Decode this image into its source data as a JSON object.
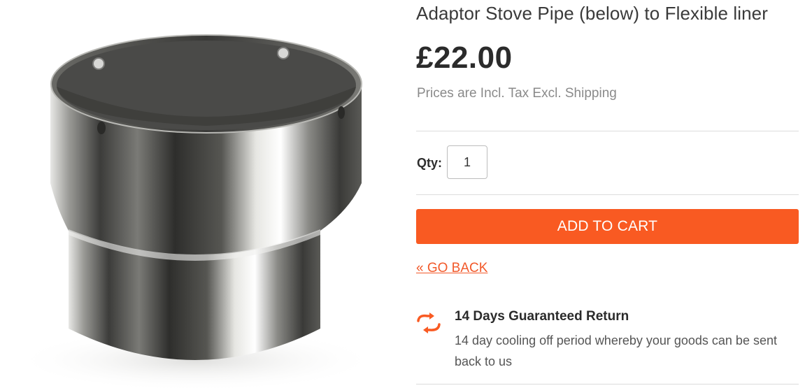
{
  "product": {
    "title": "Adaptor Stove Pipe (below) to Flexible liner",
    "price": "£22.00",
    "tax_note": "Prices are Incl. Tax Excl. Shipping",
    "image_name": "adaptor-stove-pipe-image"
  },
  "quantity": {
    "label": "Qty:",
    "value": "1"
  },
  "actions": {
    "add_to_cart": "ADD TO CART",
    "go_back": "« GO BACK"
  },
  "guarantee": {
    "icon": "return-arrows-icon",
    "title": "14 Days Guaranteed Return",
    "text": "14 day cooling off period whereby your goods can be sent back to us"
  },
  "colors": {
    "accent": "#f95a22",
    "link": "#f2592a",
    "divider": "#dcdcdc"
  }
}
